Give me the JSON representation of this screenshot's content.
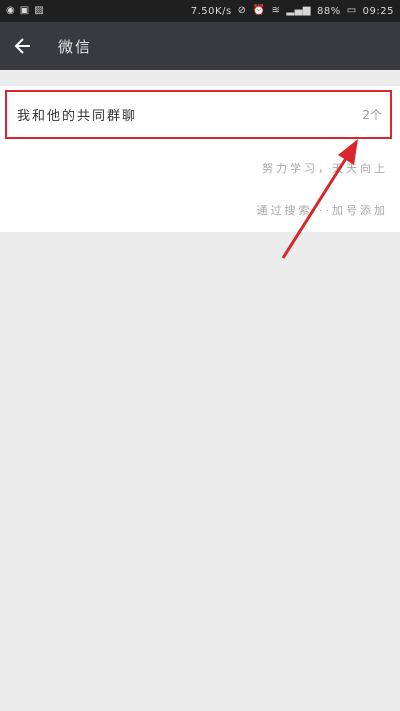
{
  "status_bar": {
    "left_icons": [
      "app-notification-icon",
      "camera-icon",
      "image-icon"
    ],
    "speed": "7.50K/s",
    "battery": "88%",
    "time": "09:25"
  },
  "app_bar": {
    "title": "微信"
  },
  "group_row": {
    "label": "我和他的共同群聊",
    "count": "2个"
  },
  "hints": [
    "努力学习，天天向上",
    "通过搜索···加号添加"
  ],
  "colors": {
    "highlight": "#d9262c",
    "app_bar": "#393a3f"
  }
}
